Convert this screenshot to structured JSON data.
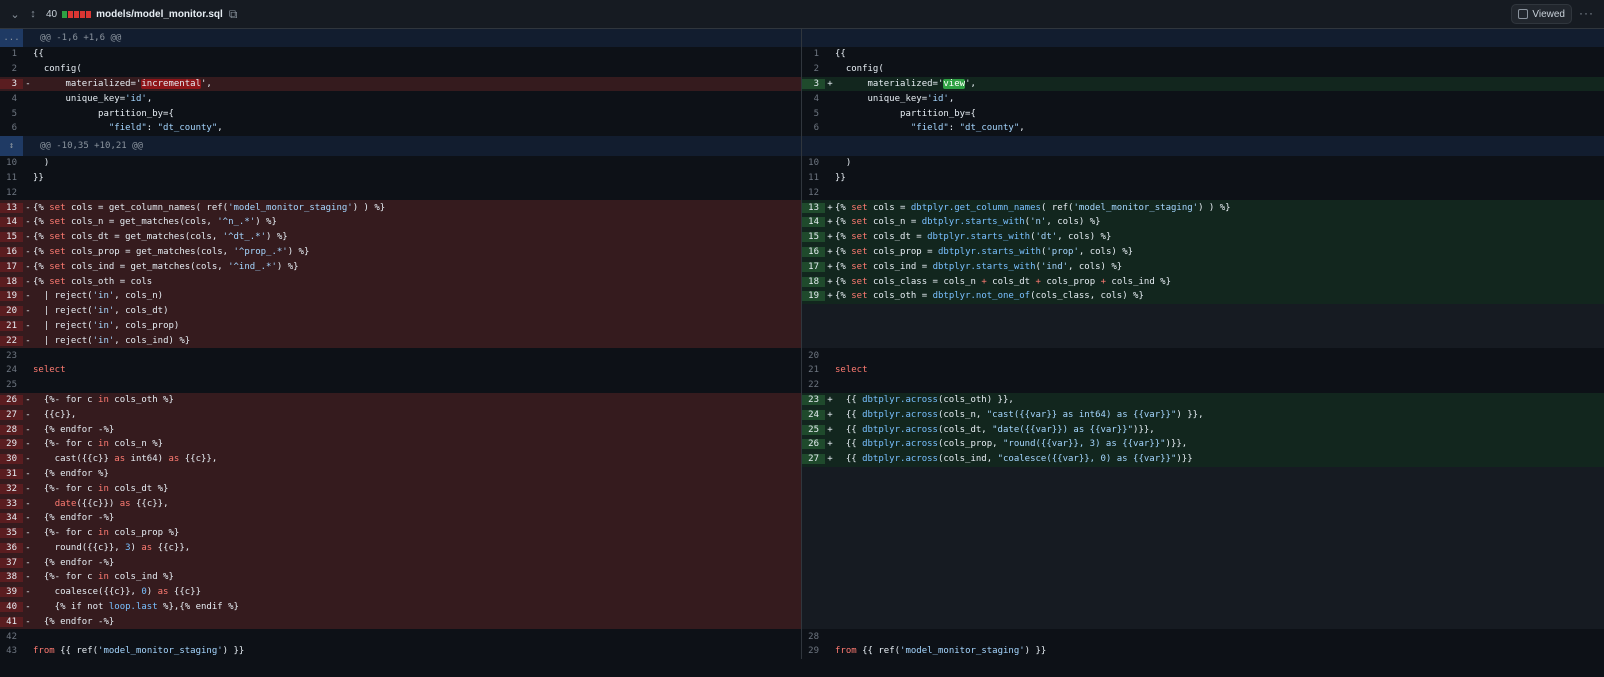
{
  "file": {
    "lines_changed": "40",
    "filename": "models/model_monitor.sql",
    "viewed_label": "Viewed"
  },
  "hunks": {
    "expand_glyph": "...",
    "first": "@@ -1,6 +1,6 @@",
    "second": "@@ -10,35 +10,21 @@"
  },
  "left": {
    "l1": "1",
    "l2": "2",
    "l3": "3",
    "l4": "4",
    "l5": "5",
    "l6": "6",
    "l10": "10",
    "l11": "11",
    "l12": "12",
    "l13": "13",
    "l14": "14",
    "l15": "15",
    "l16": "16",
    "l17": "17",
    "l18": "18",
    "l19": "19",
    "l20": "20",
    "l21": "21",
    "l22": "22",
    "l23": "23",
    "l24": "24",
    "l25": "25",
    "l26": "26",
    "l27": "27",
    "l28": "28",
    "l29": "29",
    "l30": "30",
    "l31": "31",
    "l32": "32",
    "l33": "33",
    "l34": "34",
    "l35": "35",
    "l36": "36",
    "l37": "37",
    "l38": "38",
    "l39": "39",
    "l40": "40",
    "l41": "41",
    "l42": "42",
    "l43": "43"
  },
  "right": {
    "r1": "1",
    "r2": "2",
    "r3": "3",
    "r4": "4",
    "r5": "5",
    "r6": "6",
    "r10": "10",
    "r11": "11",
    "r12": "12",
    "r13": "13",
    "r14": "14",
    "r15": "15",
    "r16": "16",
    "r17": "17",
    "r18": "18",
    "r19": "19",
    "r20": "20",
    "r21": "21",
    "r22": "22",
    "r23": "23",
    "r24": "24",
    "r25": "25",
    "r26": "26",
    "r27": "27",
    "r28": "28",
    "r29": "29"
  },
  "markers": {
    "del": "-",
    "add": "+"
  },
  "code": {
    "open_braces": "{{",
    "config": "  config(",
    "mat_left_pre": "      materialized='",
    "mat_left_word": "incremental",
    "mat_right_pre": "      materialized='",
    "mat_right_word": "view",
    "mat_post": "',",
    "unique_key_pre": "      unique_key=",
    "unique_key_val": "'id'",
    "unique_key_post": ",",
    "partition_by": "            partition_by={",
    "field_pre": "              ",
    "field_key": "\"field\"",
    "field_mid": ": ",
    "field_val": "\"dt_county\"",
    "field_post": ",",
    "close_paren": "  )",
    "close_braces": "}}",
    "select": "select",
    "from_pre": "from {{ ref(",
    "from_val": "'model_monitor_staging'",
    "from_post": ") }}"
  },
  "icons": {
    "chevron": "chevron-down-icon",
    "unfold": "unfold-icon",
    "copy": "copy-icon",
    "kebab": "kebab-horizontal-icon",
    "expand": "expand-icon"
  },
  "colors": {
    "deleted_bg": "#351b1e",
    "added_bg": "#12261e",
    "keyword": "#ff7b72",
    "string": "#a5d6ff",
    "function": "#79c0ff"
  }
}
